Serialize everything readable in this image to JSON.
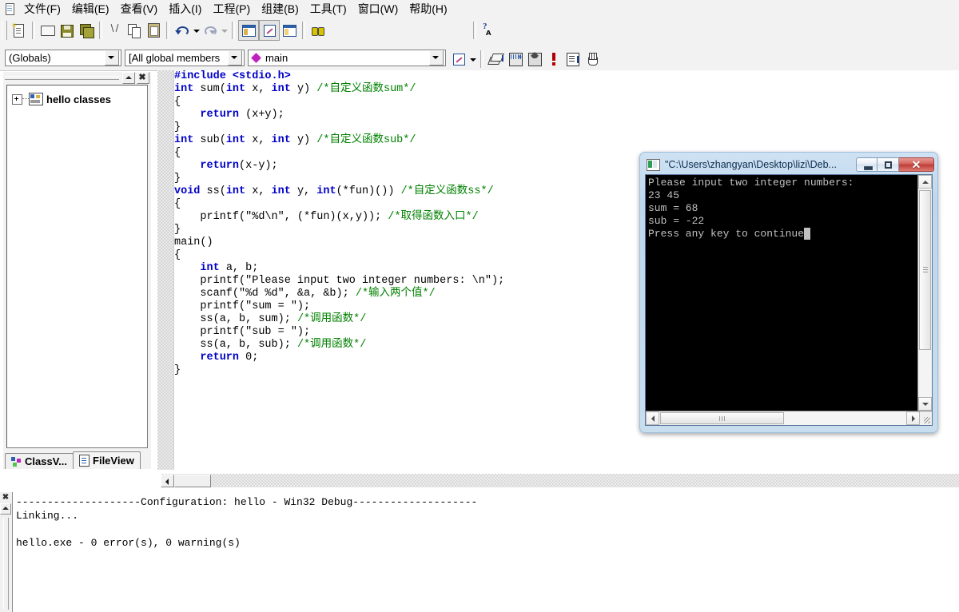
{
  "app": {
    "icon": "document-icon"
  },
  "menubar": {
    "items": [
      {
        "label": "文件(F)",
        "name": "menu-file"
      },
      {
        "label": "编辑(E)",
        "name": "menu-edit"
      },
      {
        "label": "查看(V)",
        "name": "menu-view"
      },
      {
        "label": "插入(I)",
        "name": "menu-insert"
      },
      {
        "label": "工程(P)",
        "name": "menu-project"
      },
      {
        "label": "组建(B)",
        "name": "menu-build"
      },
      {
        "label": "工具(T)",
        "name": "menu-tools"
      },
      {
        "label": "窗口(W)",
        "name": "menu-window"
      },
      {
        "label": "帮助(H)",
        "name": "menu-help"
      }
    ]
  },
  "toolbar_standard": {
    "buttons": [
      {
        "name": "new-file-button",
        "icon": "new-document-icon"
      },
      {
        "name": "open-file-button",
        "icon": "open-folder-icon"
      },
      {
        "name": "save-button",
        "icon": "floppy-disk-icon"
      },
      {
        "name": "save-all-button",
        "icon": "save-all-icon"
      },
      {
        "name": "cut-button",
        "icon": "scissors-icon"
      },
      {
        "name": "copy-button",
        "icon": "copy-icon"
      },
      {
        "name": "paste-button",
        "icon": "clipboard-paste-icon"
      },
      {
        "name": "undo-button",
        "icon": "undo-arrow-icon"
      },
      {
        "name": "redo-button",
        "icon": "redo-arrow-icon"
      },
      {
        "name": "workspace-toggle-button",
        "icon": "workspace-window-icon"
      },
      {
        "name": "output-toggle-button",
        "icon": "output-window-icon"
      },
      {
        "name": "window-list-button",
        "icon": "windows-list-icon"
      },
      {
        "name": "find-in-files-button",
        "icon": "binoculars-icon"
      },
      {
        "name": "help-search-button",
        "icon": "question-binoculars-icon"
      }
    ],
    "search_box": {
      "value": "",
      "placeholder": ""
    }
  },
  "toolbar_wizard": {
    "combo_globals": {
      "value": "(Globals)"
    },
    "combo_members": {
      "value": "[All global members"
    },
    "combo_symbol": {
      "value": "main",
      "bullet": "member-diamond-icon"
    },
    "buttons": [
      {
        "name": "classwizard-button",
        "icon": "classwizard-icon"
      },
      {
        "name": "compile-button",
        "icon": "compile-icon"
      },
      {
        "name": "build-button",
        "icon": "build-icon"
      },
      {
        "name": "stop-build-button",
        "icon": "stop-build-icon"
      },
      {
        "name": "breakpoint-button",
        "icon": "exclamation-icon"
      },
      {
        "name": "execute-program-button",
        "icon": "execute-icon"
      },
      {
        "name": "pause-button",
        "icon": "hand-icon"
      }
    ]
  },
  "workspace": {
    "titlebar": {
      "minimize_name": "workspace-minimize-button",
      "close_name": "workspace-close-button",
      "close_label": "✖"
    },
    "tree": [
      {
        "label": "hello classes",
        "icon": "classes-folder-icon",
        "expander": "plus-expander"
      }
    ],
    "tabs": [
      {
        "label": "ClassV...",
        "name": "tab-classview",
        "icon": "classview-icon",
        "active": false
      },
      {
        "label": "FileView",
        "name": "tab-fileview",
        "icon": "fileview-icon",
        "active": true
      }
    ]
  },
  "editor": {
    "code_lines": [
      [
        {
          "t": "#include ",
          "c": "pp"
        },
        {
          "t": "<stdio.h>",
          "c": "pp"
        }
      ],
      [
        {
          "t": "int",
          "c": "kw"
        },
        {
          "t": " sum(",
          "c": "pl"
        },
        {
          "t": "int",
          "c": "kw"
        },
        {
          "t": " x, ",
          "c": "pl"
        },
        {
          "t": "int",
          "c": "kw"
        },
        {
          "t": " y) ",
          "c": "pl"
        },
        {
          "t": "/*自定义函数sum*/",
          "c": "cm"
        }
      ],
      [
        {
          "t": "{",
          "c": "pl"
        }
      ],
      [
        {
          "t": "    ",
          "c": "pl"
        },
        {
          "t": "return",
          "c": "kw"
        },
        {
          "t": " (x+y);",
          "c": "pl"
        }
      ],
      [
        {
          "t": "}",
          "c": "pl"
        }
      ],
      [
        {
          "t": "int",
          "c": "kw"
        },
        {
          "t": " sub(",
          "c": "pl"
        },
        {
          "t": "int",
          "c": "kw"
        },
        {
          "t": " x, ",
          "c": "pl"
        },
        {
          "t": "int",
          "c": "kw"
        },
        {
          "t": " y) ",
          "c": "pl"
        },
        {
          "t": "/*自定义函数sub*/",
          "c": "cm"
        }
      ],
      [
        {
          "t": "{",
          "c": "pl"
        }
      ],
      [
        {
          "t": "    ",
          "c": "pl"
        },
        {
          "t": "return",
          "c": "kw"
        },
        {
          "t": "(x-y);",
          "c": "pl"
        }
      ],
      [
        {
          "t": "}",
          "c": "pl"
        }
      ],
      [
        {
          "t": "void",
          "c": "kw"
        },
        {
          "t": " ss(",
          "c": "pl"
        },
        {
          "t": "int",
          "c": "kw"
        },
        {
          "t": " x, ",
          "c": "pl"
        },
        {
          "t": "int",
          "c": "kw"
        },
        {
          "t": " y, ",
          "c": "pl"
        },
        {
          "t": "int",
          "c": "kw"
        },
        {
          "t": "(*fun)()) ",
          "c": "pl"
        },
        {
          "t": "/*自定义函数ss*/",
          "c": "cm"
        }
      ],
      [
        {
          "t": "{",
          "c": "pl"
        }
      ],
      [
        {
          "t": "    printf(\"%d\\n\", (*fun)(x,y)); ",
          "c": "pl"
        },
        {
          "t": "/*取得函数入口*/",
          "c": "cm"
        }
      ],
      [
        {
          "t": "}",
          "c": "pl"
        }
      ],
      [
        {
          "t": "main()",
          "c": "pl"
        }
      ],
      [
        {
          "t": "{",
          "c": "pl"
        }
      ],
      [
        {
          "t": "    ",
          "c": "pl"
        },
        {
          "t": "int",
          "c": "kw"
        },
        {
          "t": " a, b;",
          "c": "pl"
        }
      ],
      [
        {
          "t": "    printf(\"Please input two integer numbers: \\n\");",
          "c": "pl"
        }
      ],
      [
        {
          "t": "    scanf(\"%d %d\", &a, &b); ",
          "c": "pl"
        },
        {
          "t": "/*输入两个值*/",
          "c": "cm"
        }
      ],
      [
        {
          "t": "    printf(\"sum = \");",
          "c": "pl"
        }
      ],
      [
        {
          "t": "    ss(a, b, sum); ",
          "c": "pl"
        },
        {
          "t": "/*调用函数*/",
          "c": "cm"
        }
      ],
      [
        {
          "t": "    printf(\"sub = \");",
          "c": "pl"
        }
      ],
      [
        {
          "t": "    ss(a, b, sub); ",
          "c": "pl"
        },
        {
          "t": "/*调用函数*/",
          "c": "cm"
        }
      ],
      [
        {
          "t": "    ",
          "c": "pl"
        },
        {
          "t": "return",
          "c": "kw"
        },
        {
          "t": " 0;",
          "c": "pl"
        }
      ],
      [
        {
          "t": "}",
          "c": "pl"
        }
      ]
    ]
  },
  "output": {
    "text": "--------------------Configuration: hello - Win32 Debug--------------------\nLinking...\n\nhello.exe - 0 error(s), 0 warning(s)",
    "close_label": "✖"
  },
  "console": {
    "title": "\"C:\\Users\\zhangyan\\Desktop\\lizi\\Deb...",
    "icon": "console-app-icon",
    "buttons": {
      "minimize": "–",
      "maximize": "□",
      "close": "✕"
    },
    "text_lines": [
      "Please input two integer numbers:",
      "23 45",
      "sum = 68",
      "sub = -22"
    ],
    "last_line": "Press any key to continue",
    "cursor": "_"
  },
  "colors": {
    "keyword": "#0000c8",
    "comment": "#008000",
    "console_bg": "#000000",
    "console_fg": "#c0c0c0",
    "close_button": "#bc3c36",
    "accent": "#2f62ad"
  }
}
